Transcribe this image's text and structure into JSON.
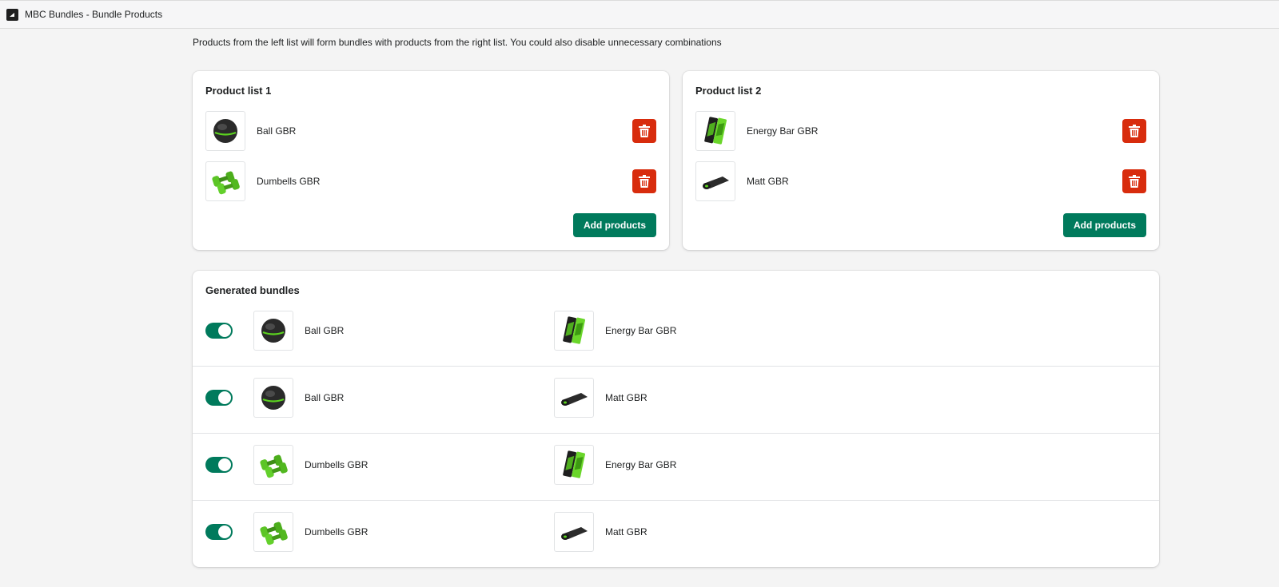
{
  "window": {
    "title": "MBC Bundles - Bundle Products",
    "icon": "app-logo-icon"
  },
  "intro": "Products from the left list will form bundles with products from the right list. You could also disable unnecessary combinations",
  "list1": {
    "title": "Product list 1",
    "products": [
      {
        "name": "Ball GBR",
        "icon": "ball-icon"
      },
      {
        "name": "Dumbells GBR",
        "icon": "dumbbells-icon"
      }
    ],
    "add_label": "Add products"
  },
  "list2": {
    "title": "Product list 2",
    "products": [
      {
        "name": "Energy Bar GBR",
        "icon": "energy-bar-icon"
      },
      {
        "name": "Matt GBR",
        "icon": "mat-icon"
      }
    ],
    "add_label": "Add products"
  },
  "bundles": {
    "title": "Generated bundles",
    "rows": [
      {
        "enabled": true,
        "left": "Ball GBR",
        "right": "Energy Bar GBR"
      },
      {
        "enabled": true,
        "left": "Ball GBR",
        "right": "Matt GBR"
      },
      {
        "enabled": true,
        "left": "Dumbells GBR",
        "right": "Energy Bar GBR"
      },
      {
        "enabled": true,
        "left": "Dumbells GBR",
        "right": "Matt GBR"
      }
    ]
  },
  "colors": {
    "primary": "#007a5c",
    "danger": "#d82c0d",
    "background": "#f4f4f4"
  }
}
